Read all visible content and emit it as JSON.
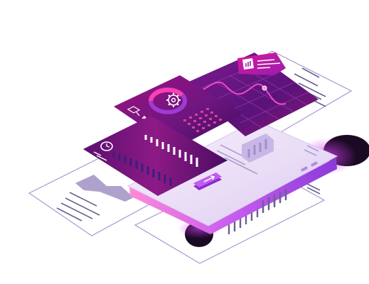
{
  "illustration": {
    "subject": "isometric-mobile-analytics-dashboard",
    "palette": {
      "deep_purple": "#4b0b63",
      "purple": "#6a1b8e",
      "magenta": "#c0148b",
      "violet": "#8e2bc9",
      "lavender": "#e9dcf6",
      "light_lavender": "#f3ecfb",
      "outline": "#9b86c4",
      "shadow": "#1b0a23"
    },
    "icons": [
      "gear-icon",
      "bar-chart-icon",
      "clock-icon",
      "arrow-right-icon",
      "arrow-down-icon",
      "arrow-up-icon"
    ],
    "panels": [
      "background-document-left",
      "background-document-right",
      "background-document-bottom",
      "phone-device",
      "dashboard-panel-gear",
      "dashboard-panel-line-chart",
      "dashboard-panel-bar-chart"
    ]
  }
}
